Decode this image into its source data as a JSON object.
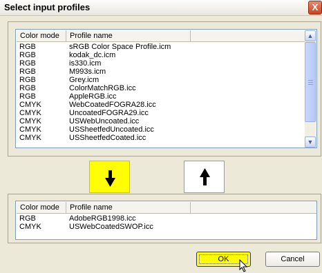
{
  "window": {
    "title": "Select input profiles",
    "close_glyph": "X"
  },
  "top_list": {
    "headers": [
      "Color mode",
      "Profile name"
    ],
    "rows": [
      {
        "mode": "RGB",
        "name": "sRGB Color Space Profile.icm"
      },
      {
        "mode": "RGB",
        "name": "kodak_dc.icm"
      },
      {
        "mode": "RGB",
        "name": "is330.icm"
      },
      {
        "mode": "RGB",
        "name": "M993s.icm"
      },
      {
        "mode": "RGB",
        "name": "Grey.icm"
      },
      {
        "mode": "RGB",
        "name": "ColorMatchRGB.icc"
      },
      {
        "mode": "RGB",
        "name": "AppleRGB.icc"
      },
      {
        "mode": "CMYK",
        "name": "WebCoatedFOGRA28.icc"
      },
      {
        "mode": "CMYK",
        "name": "UncoatedFOGRA29.icc"
      },
      {
        "mode": "CMYK",
        "name": "USWebUncoated.icc"
      },
      {
        "mode": "CMYK",
        "name": "USSheetfedUncoated.icc"
      },
      {
        "mode": "CMYK",
        "name": "USSheetfedCoated.icc"
      }
    ]
  },
  "bottom_list": {
    "headers": [
      "Color mode",
      "Profile name"
    ],
    "rows": [
      {
        "mode": "RGB",
        "name": "AdobeRGB1998.icc"
      },
      {
        "mode": "CMYK",
        "name": "USWebCoatedSWOP.icc"
      }
    ]
  },
  "buttons": {
    "add_icon": "arrow-down-icon",
    "remove_icon": "arrow-up-icon",
    "ok_label": "OK",
    "cancel_label": "Cancel"
  },
  "colors": {
    "highlight_yellow": "#ffff00",
    "list_border": "#7f9db9",
    "dialog_bg": "#ece9d8",
    "close_red": "#d45a36"
  }
}
